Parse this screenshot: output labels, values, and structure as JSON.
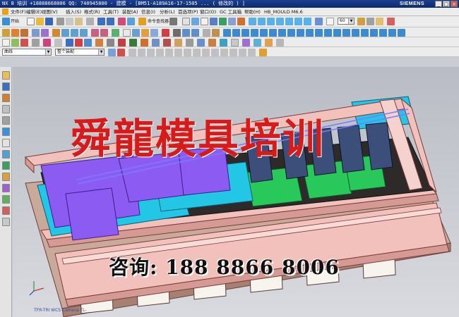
{
  "window": {
    "title": "NX 8 培训 +18888668006 QQ: 740945800 - 建模 - [BM51-A189A16-17-1505 ... ( 修改的 ) ]",
    "brand": "SIEMENS",
    "controls": [
      "_",
      "□",
      "×"
    ]
  },
  "menubar": {
    "items": [
      "文件(F)",
      "编辑(E)",
      "视图(V)",
      "插入(S)",
      "格式(R)",
      "工具(T)",
      "装配(A)",
      "信息(I)",
      "分析(L)",
      "首选项(P)",
      "窗口(O)",
      "GC 工具箱",
      "帮助(H)",
      "HB_MOULD M6.6"
    ]
  },
  "toolbar": {
    "start_label": "开始",
    "command_finder_label": "命令查找器",
    "zoom_select": "60"
  },
  "selection_bar": {
    "filter_select": "曲线",
    "scope_select": "整个装配"
  },
  "viewport": {
    "watermark_title": "舜龍模具培训",
    "watermark_contact": "咨询: 188 8866 8006",
    "view_label": "TFR-TRI WCS Camera TL-"
  },
  "colors": {
    "titlebar": "#0c2a6d",
    "plate": "#f2c1bb",
    "slider": "#8c5cf2",
    "insert": "#24c6e6",
    "block": "#28c85a",
    "watermark_red": "#d71a1a"
  }
}
